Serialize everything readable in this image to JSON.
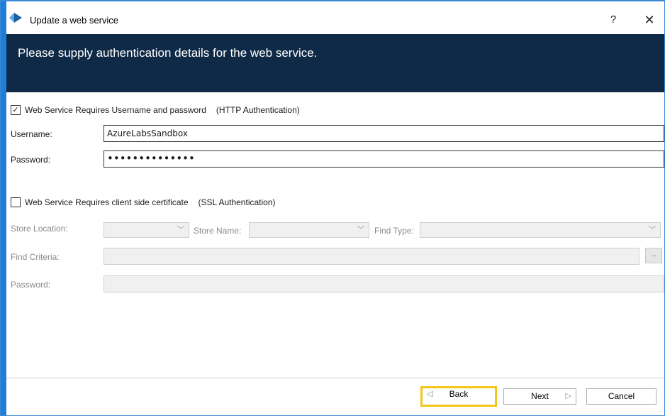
{
  "window": {
    "title": "Update a web service",
    "help_label": "?",
    "close_label": "✕"
  },
  "banner": {
    "text": "Please supply authentication details for the web service."
  },
  "http_auth": {
    "checked": true,
    "check_glyph": "✓",
    "label": "Web Service Requires Username and password",
    "note": "(HTTP Authentication)",
    "username_label": "Username:",
    "username_value": "AzureLabsSandbox",
    "password_label": "Password:",
    "password_value": "••••••••••••••"
  },
  "ssl_auth": {
    "checked": false,
    "label": "Web Service Requires client side certificate",
    "note": "(SSL Authentication)",
    "store_location_label": "Store Location:",
    "store_location_value": "",
    "store_name_label": "Store Name:",
    "store_name_value": "",
    "find_type_label": "Find Type:",
    "find_type_value": "",
    "find_criteria_label": "Find Criteria:",
    "find_criteria_value": "",
    "browse_label": "...",
    "password_label": "Password:",
    "password_value": ""
  },
  "footer": {
    "back_label": "Back",
    "next_label": "Next",
    "cancel_label": "Cancel"
  },
  "icons": [
    "app-icon",
    "help-icon",
    "close-icon",
    "checkmark-icon",
    "chevron-down-icon",
    "chevron-left-icon",
    "chevron-right-icon",
    "resize-grip-icon"
  ],
  "colors": {
    "banner_bg": "#0f2a47",
    "window_accent": "#1f7fd6",
    "focus_ring": "#f5c518"
  }
}
